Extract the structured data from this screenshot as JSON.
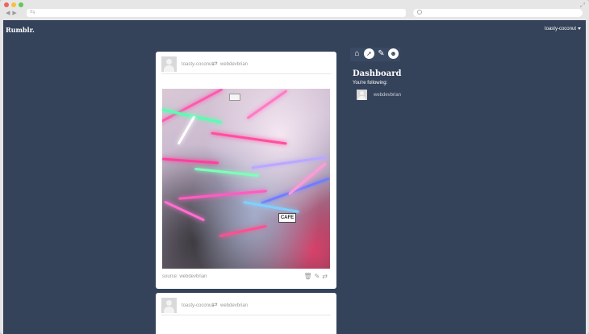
{
  "browser": {
    "url_icon": "⇆"
  },
  "topbar": {
    "logo": "Rumblr.",
    "username": "toasty-coconut"
  },
  "posts": [
    {
      "author": "toasty-coconut",
      "reblogged_from": "webdevbrian",
      "photo_sign": "CAFE",
      "source": "source: webdevbrian"
    },
    {
      "author": "toasty-coconut",
      "reblogged_from": "webdevbrian"
    }
  ],
  "sidebar": {
    "icons": [
      "home-icon",
      "compass-icon",
      "pencil-icon",
      "smiley-icon"
    ],
    "title": "Dashboard",
    "following_label": "You're following:",
    "following": [
      {
        "name": "webdevbrian"
      }
    ]
  },
  "colors": {
    "page_bg": "#34425a",
    "sidebar_icon_bg": "#3b4a63",
    "card_bg": "#ffffff",
    "muted_text": "#9a9a9a"
  }
}
